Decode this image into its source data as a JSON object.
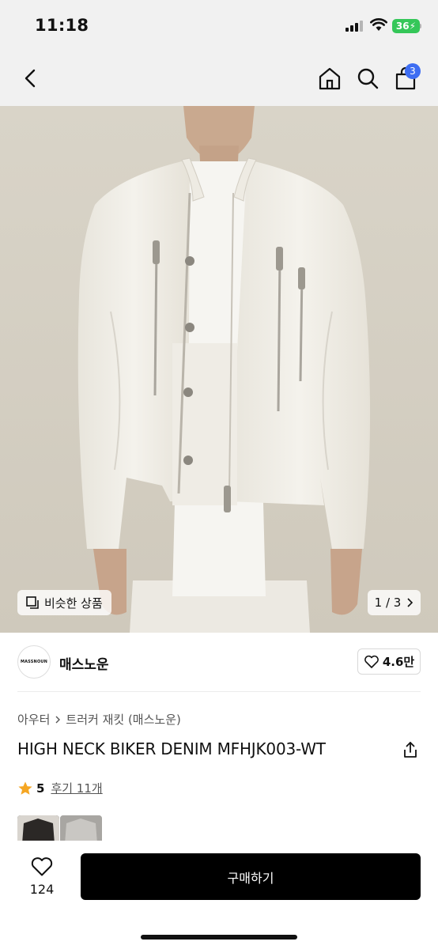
{
  "status_bar": {
    "time": "11:18",
    "battery": "36"
  },
  "nav": {
    "cart_count": "3"
  },
  "image": {
    "similar_label": "비슷한 상품",
    "page_indicator": "1 / 3"
  },
  "brand": {
    "logo_text": "MASSNOUN",
    "name": "매스노운",
    "like_count": "4.6만"
  },
  "product": {
    "breadcrumb": [
      "아우터",
      "트러커 재킷 (매스노운)"
    ],
    "title": "HIGH NECK BIKER DENIM MFHJK003-WT",
    "rating": "5",
    "review_label": "후기 11개"
  },
  "bottom_bar": {
    "wish_count": "124",
    "buy_label": "구매하기"
  },
  "colors": {
    "accent_blue": "#3d6df2",
    "star": "#f5a623",
    "buy_button": "#000000"
  }
}
